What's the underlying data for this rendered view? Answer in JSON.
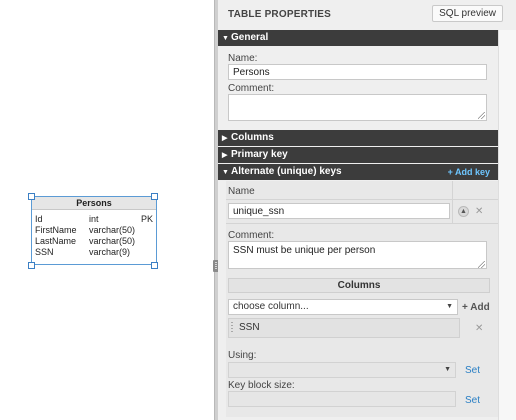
{
  "canvas": {
    "table": {
      "name": "Persons",
      "columns": [
        {
          "name": "Id",
          "type": "int",
          "key": "PK"
        },
        {
          "name": "FirstName",
          "type": "varchar(50)",
          "key": ""
        },
        {
          "name": "LastName",
          "type": "varchar(50)",
          "key": ""
        },
        {
          "name": "SSN",
          "type": "varchar(9)",
          "key": ""
        }
      ]
    }
  },
  "panel": {
    "title": "TABLE PROPERTIES",
    "sql_preview_label": "SQL preview",
    "general": {
      "header": "General",
      "name_label": "Name:",
      "name_value": "Persons",
      "comment_label": "Comment:",
      "comment_value": ""
    },
    "sections": {
      "columns": "Columns",
      "primary_key": "Primary key",
      "alternate_keys": "Alternate (unique) keys",
      "add_key": "+ Add key"
    },
    "alternate_key": {
      "name_header": "Name",
      "name_value": "unique_ssn",
      "move_up_icon": "triangle-up",
      "remove_icon": "close",
      "comment_label": "Comment:",
      "comment_value": "SSN must be unique per person",
      "columns_header": "Columns",
      "choose_column_placeholder": "choose column...",
      "add_label": "+ Add",
      "columns": [
        "SSN"
      ],
      "using_label": "Using:",
      "using_value": "",
      "set_label": "Set",
      "key_block_size_label": "Key block size:",
      "key_block_size_value": ""
    }
  },
  "colors": {
    "section_bar": "#3c3c3c",
    "add_key_link": "#6ec6ff",
    "set_link": "#2a7fc4",
    "selection_border": "#5b9bd5"
  }
}
